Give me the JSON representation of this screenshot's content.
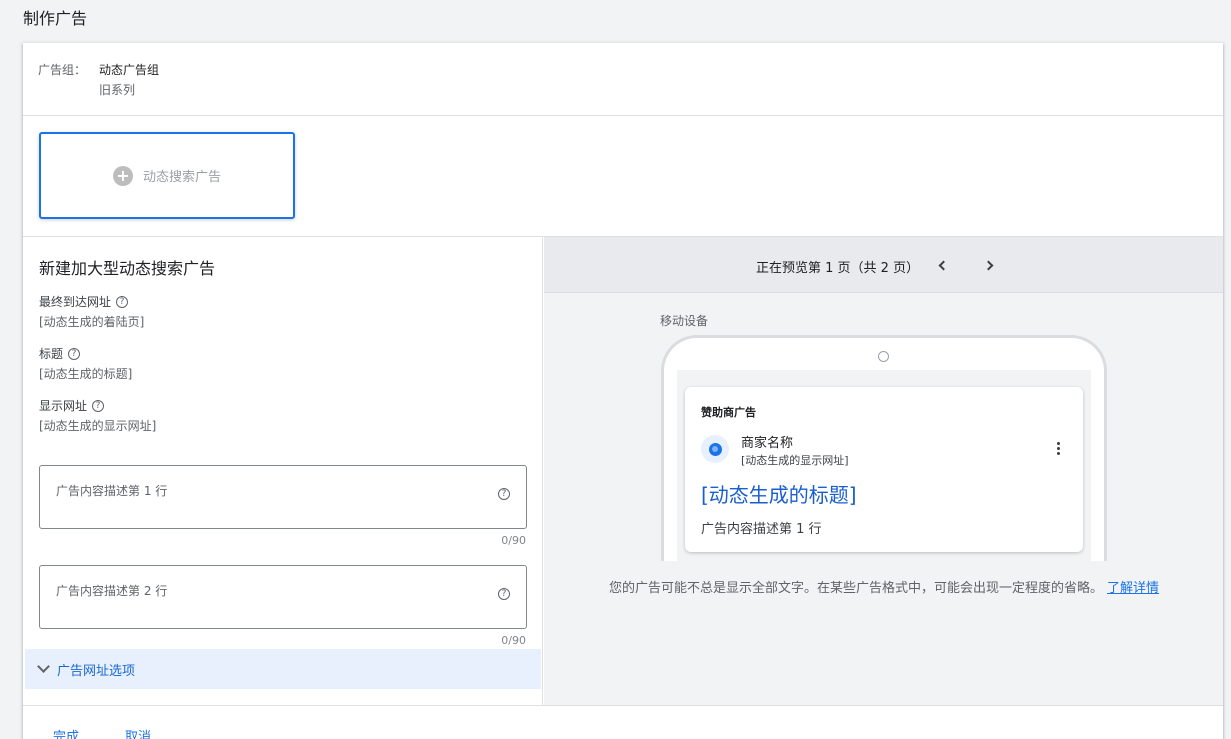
{
  "page": {
    "title": "制作广告"
  },
  "ad_group": {
    "label": "广告组：",
    "name": "动态广告组",
    "campaign": "旧系列"
  },
  "ad_type": {
    "label": "动态搜索广告",
    "icon": "plus-circle-icon"
  },
  "editor": {
    "title": "新建加大型动态搜索广告",
    "final_url_label": "最终到达网址",
    "final_url_value": "[动态生成的着陆页]",
    "headline_label": "标题",
    "headline_value": "[动态生成的标题]",
    "display_url_label": "显示网址",
    "display_url_value": "[动态生成的显示网址]",
    "description1_placeholder": "广告内容描述第 1 行",
    "description1_counter": "0/90",
    "description2_placeholder": "广告内容描述第 2 行",
    "description2_counter": "0/90",
    "url_options_label": "广告网址选项"
  },
  "preview": {
    "status": "正在预览第 1 页（共 2 页）",
    "device_label": "移动设备",
    "ad": {
      "sponsored": "赞助商广告",
      "business_name": "商家名称",
      "display_url": "[动态生成的显示网址]",
      "headline": "[动态生成的标题]",
      "description": "广告内容描述第 1 行"
    },
    "disclaimer": "您的广告可能不总是显示全部文字。在某些广告格式中，可能会出现一定程度的省略。",
    "learn_more": "了解详情"
  },
  "footer": {
    "done": "完成",
    "cancel": "取消"
  },
  "colors": {
    "accent": "#1a73e8",
    "highlight": "#e8f0fe"
  }
}
